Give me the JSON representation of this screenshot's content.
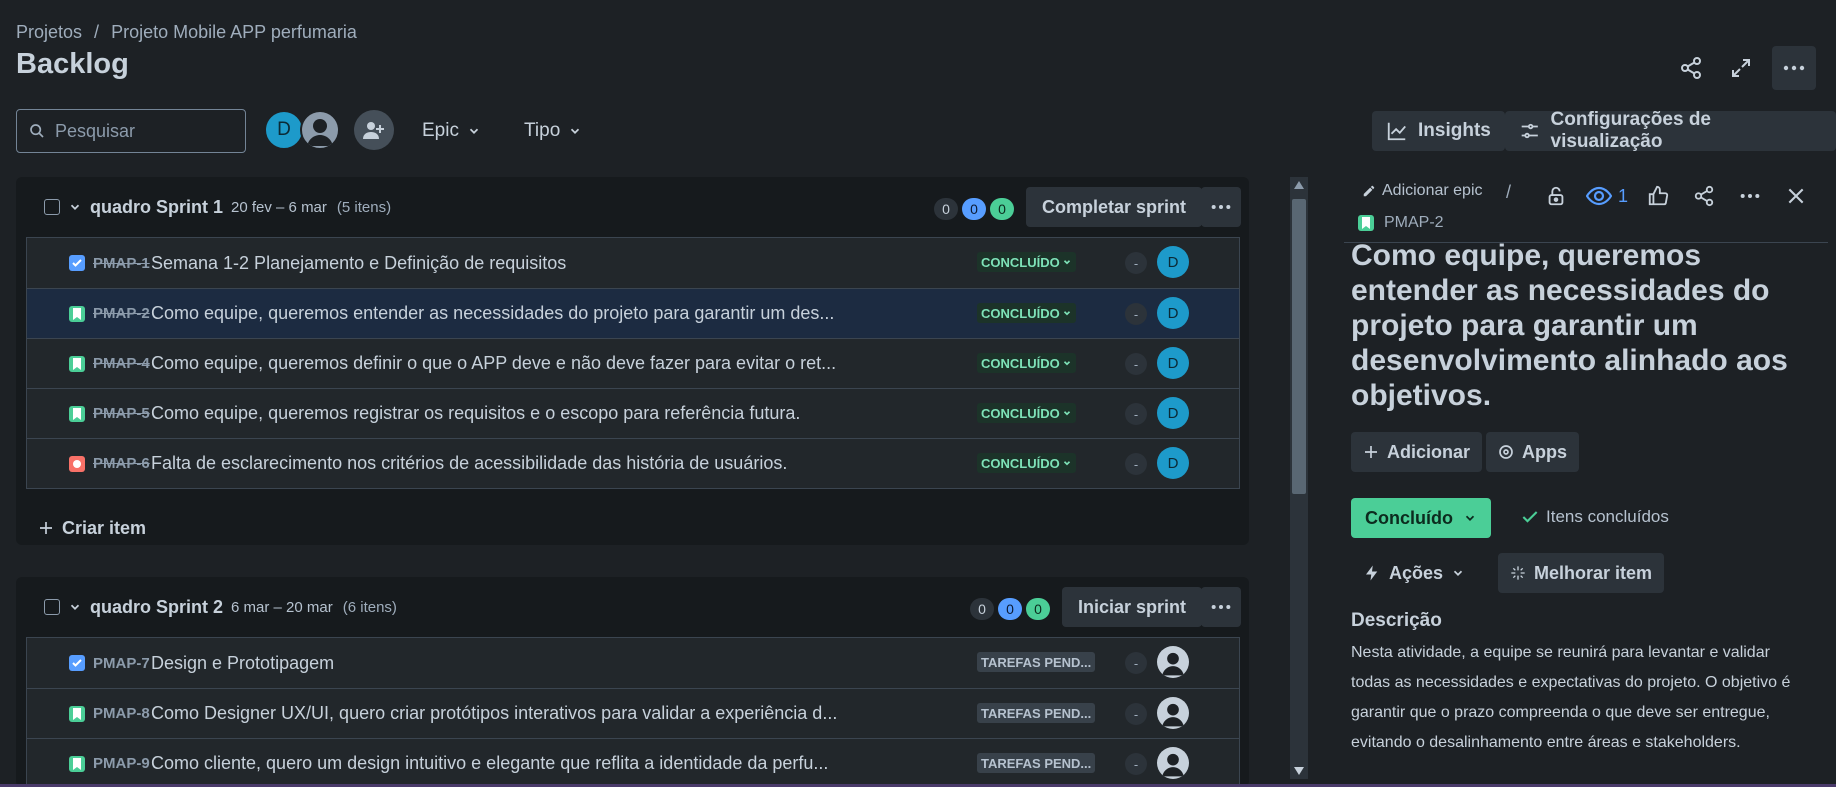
{
  "breadcrumb": {
    "root": "Projetos",
    "separator": "/",
    "project": "Projeto Mobile APP perfumaria"
  },
  "page": {
    "title": "Backlog"
  },
  "toolbar": {
    "search_placeholder": "Pesquisar",
    "avatar_initial": "D",
    "filters": [
      "Epic",
      "Tipo"
    ],
    "insights_label": "Insights",
    "view_settings_label": "Configurações de visualização"
  },
  "sprints": [
    {
      "name": "quadro Sprint 1",
      "dates": "20 fev – 6 mar",
      "count": "(5 itens)",
      "counters": [
        "0",
        "0",
        "0"
      ],
      "action_label": "Completar sprint",
      "items": [
        {
          "type": "task",
          "key": "PMAP-1",
          "summary": "Semana 1-2 Planejamento e Definição de requisitos",
          "status": "CONCLUÍDO",
          "points": "-",
          "assignee": "D"
        },
        {
          "type": "story",
          "key": "PMAP-2",
          "summary": "Como equipe, queremos entender as necessidades do projeto para garantir um des...",
          "status": "CONCLUÍDO",
          "points": "-",
          "assignee": "D"
        },
        {
          "type": "story",
          "key": "PMAP-4",
          "summary": "Como equipe, queremos definir o que o APP deve e não deve fazer para evitar o ret...",
          "status": "CONCLUÍDO",
          "points": "-",
          "assignee": "D"
        },
        {
          "type": "story",
          "key": "PMAP-5",
          "summary": "Como equipe, queremos registrar os requisitos e o escopo para referência futura.",
          "status": "CONCLUÍDO",
          "points": "-",
          "assignee": "D"
        },
        {
          "type": "bug",
          "key": "PMAP-6",
          "summary": "Falta de esclarecimento nos critérios de acessibilidade das história de usuários.",
          "status": "CONCLUÍDO",
          "points": "-",
          "assignee": "D"
        }
      ],
      "create_label": "Criar item"
    },
    {
      "name": "quadro Sprint 2",
      "dates": "6 mar – 20 mar",
      "count": "(6 itens)",
      "counters": [
        "0",
        "0",
        "0"
      ],
      "action_label": "Iniciar sprint",
      "items": [
        {
          "type": "task",
          "key": "PMAP-7",
          "summary": "Design e Prototipagem",
          "status": "TAREFAS PEND...",
          "points": "-"
        },
        {
          "type": "story",
          "key": "PMAP-8",
          "summary": "Como Designer UX/UI, quero criar protótipos interativos para validar a experiência d...",
          "status": "TAREFAS PEND...",
          "points": "-"
        },
        {
          "type": "story",
          "key": "PMAP-9",
          "summary": "Como cliente, quero um design intuitivo e elegante que reflita a identidade da perfu...",
          "status": "TAREFAS PEND...",
          "points": "-"
        }
      ]
    }
  ],
  "detail": {
    "add_epic_label": "Adicionar epic",
    "separator": "/",
    "watch_count": "1",
    "key": "PMAP-2",
    "title": "Como equipe, queremos entender as necessidades do projeto para garantir um desenvolvimento alinhado aos objetivos.",
    "add_label": "Adicionar",
    "apps_label": "Apps",
    "status_label": "Concluído",
    "resolution_label": "Itens concluídos",
    "actions_label": "Ações",
    "improve_label": "Melhorar item",
    "description_heading": "Descrição",
    "description": "Nesta atividade, a equipe se reunirá para levantar e validar todas as necessidades e expectativas do projeto. O objetivo é garantir que o prazo compreenda o que deve ser entregue, evitando o desalinhamento entre áreas e stakeholders."
  },
  "colors": {
    "background": "#1d2125",
    "done_green": "#4bce97",
    "task_blue": "#579dff",
    "bug_red": "#f87168",
    "selected_row": "#1c2b41"
  },
  "icons": [
    "search-icon",
    "share-icon",
    "expand-icon",
    "more-icon",
    "add-person-icon",
    "chevron-down-icon",
    "insights-icon",
    "settings-sliders-icon",
    "pencil-icon",
    "lock-icon",
    "eye-icon",
    "thumbs-up-icon",
    "close-icon",
    "plus-icon",
    "apps-icon",
    "check-icon",
    "lightning-icon",
    "sparkle-icon"
  ]
}
